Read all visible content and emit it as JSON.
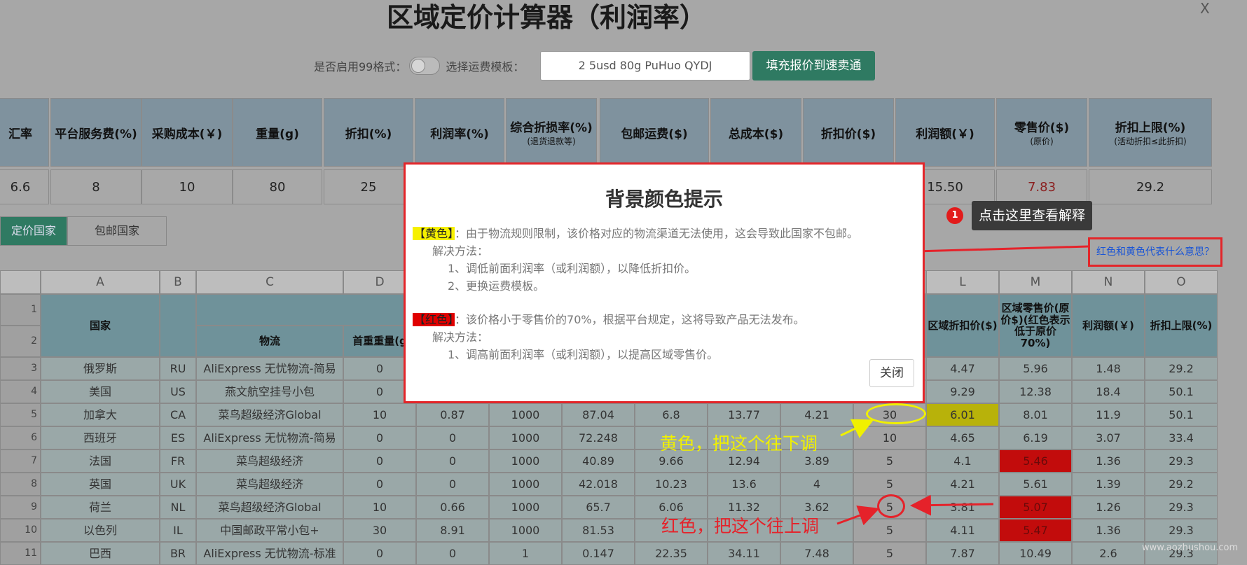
{
  "header": {
    "title": "区域定价计算器（利润率）",
    "close": "X"
  },
  "options": {
    "enable_99_label": "是否启用99格式：",
    "template_label": "选择运费模板：",
    "template_value": "2 5usd 80g PuHuo QYDJ",
    "fill_button": "填充报价到速卖通"
  },
  "params": {
    "headers": [
      {
        "label": "汇率",
        "sub": ""
      },
      {
        "label": "平台服务费(%)",
        "sub": ""
      },
      {
        "label": "采购成本(￥)",
        "sub": ""
      },
      {
        "label": "重量(g)",
        "sub": ""
      },
      {
        "label": "折扣(%)",
        "sub": ""
      },
      {
        "label": "利润率(%)",
        "sub": ""
      },
      {
        "label": "综合折损率(%)",
        "sub": "(退货退款等)"
      },
      {
        "label": "包邮运费($)",
        "sub": ""
      },
      {
        "label": "总成本($)",
        "sub": ""
      },
      {
        "label": "折扣价($)",
        "sub": ""
      },
      {
        "label": "利润额(￥)",
        "sub": ""
      },
      {
        "label": "零售价($)",
        "sub": "(原价)"
      },
      {
        "label": "折扣上限(%)",
        "sub": "(活动折扣≤此折扣)"
      }
    ],
    "values": [
      "6.6",
      "8",
      "10",
      "80",
      "25",
      "",
      "",
      "",
      "",
      "",
      "15.50",
      "7.83",
      "29.2"
    ]
  },
  "tabs": [
    "定价国家",
    "包邮国家"
  ],
  "callout": {
    "badge": "1",
    "text": "点击这里查看解释",
    "help_link": "红色和黄色代表什么意思？"
  },
  "sheet": {
    "columns": [
      "A",
      "B",
      "C",
      "D",
      "L",
      "M",
      "N",
      "O"
    ],
    "row_numbers": [
      "1",
      "2",
      "3",
      "4",
      "5",
      "6",
      "7",
      "8",
      "9",
      "10",
      "11"
    ],
    "group_headers": {
      "country": "国家",
      "logistics": "物流",
      "first_weight": "首重重量(g",
      "region_discount": "区域折扣价($)",
      "region_retail": "区域零售价(原价$)(红色表示低于原价70%)",
      "profit": "利润额(￥)",
      "discount_limit": "折扣上限(%)"
    },
    "rows": [
      {
        "country": "俄罗斯",
        "code": "RU",
        "logistics": "AliExpress 无忧物流-简易",
        "d": "0",
        "e": "",
        "f": "",
        "g": "",
        "h": "",
        "i": "",
        "j": "",
        "k": "",
        "l": "4.47",
        "m": "5.96",
        "n": "1.48",
        "o": "29.2"
      },
      {
        "country": "美国",
        "code": "US",
        "logistics": "燕文航空挂号小包",
        "d": "0",
        "e": "",
        "f": "",
        "g": "",
        "h": "",
        "i": "",
        "j": "",
        "k": "",
        "l": "9.29",
        "m": "12.38",
        "n": "18.4",
        "o": "50.1"
      },
      {
        "country": "加拿大",
        "code": "CA",
        "logistics": "菜鸟超级经济Global",
        "d": "10",
        "e": "0.87",
        "f": "1000",
        "g": "87.04",
        "h": "6.8",
        "i": "13.77",
        "j": "4.21",
        "k": "30",
        "l": "6.01",
        "m": "8.01",
        "n": "11.9",
        "o": "50.1"
      },
      {
        "country": "西班牙",
        "code": "ES",
        "logistics": "AliExpress 无忧物流-简易",
        "d": "0",
        "e": "0",
        "f": "1000",
        "g": "72.248",
        "h": "",
        "i": "",
        "j": "",
        "k": "10",
        "l": "4.65",
        "m": "6.19",
        "n": "3.07",
        "o": "33.4"
      },
      {
        "country": "法国",
        "code": "FR",
        "logistics": "菜鸟超级经济",
        "d": "0",
        "e": "0",
        "f": "1000",
        "g": "40.89",
        "h": "9.66",
        "i": "12.94",
        "j": "3.89",
        "k": "5",
        "l": "4.1",
        "m": "5.46",
        "n": "1.36",
        "o": "29.3"
      },
      {
        "country": "英国",
        "code": "UK",
        "logistics": "菜鸟超级经济",
        "d": "0",
        "e": "0",
        "f": "1000",
        "g": "42.018",
        "h": "10.23",
        "i": "13.6",
        "j": "4",
        "k": "5",
        "l": "4.21",
        "m": "5.61",
        "n": "1.39",
        "o": "29.2"
      },
      {
        "country": "荷兰",
        "code": "NL",
        "logistics": "菜鸟超级经济Global",
        "d": "10",
        "e": "0.66",
        "f": "1000",
        "g": "65.7",
        "h": "6.06",
        "i": "11.32",
        "j": "3.62",
        "k": "5",
        "l": "3.81",
        "m": "5.07",
        "n": "1.26",
        "o": "29.3"
      },
      {
        "country": "以色列",
        "code": "IL",
        "logistics": "中国邮政平常小包+",
        "d": "30",
        "e": "8.91",
        "f": "1000",
        "g": "81.53",
        "h": "",
        "i": "",
        "j": "",
        "k": "5",
        "l": "4.11",
        "m": "5.47",
        "n": "1.36",
        "o": "29.3"
      },
      {
        "country": "巴西",
        "code": "BR",
        "logistics": "AliExpress 无忧物流-标准",
        "d": "0",
        "e": "0",
        "f": "1",
        "g": "0.147",
        "h": "22.35",
        "i": "34.11",
        "j": "7.48",
        "k": "5",
        "l": "7.87",
        "m": "10.49",
        "n": "2.6",
        "o": "29.3"
      }
    ]
  },
  "modal": {
    "title": "背景颜色提示",
    "yellow_tag": "【黄色】",
    "yellow_text": "：由于物流规则限制，该价格对应的物流渠道无法使用，这会导致此国家不包邮。",
    "yellow_solution": "解决方法：",
    "yellow_fix1": "1、调低前面利润率（或利润额），以降低折扣价。",
    "yellow_fix2": "2、更换运费模板。",
    "red_tag": "【红色】",
    "red_text": "：该价格小于零售价的70%，根据平台规定，这将导致产品无法发布。",
    "red_solution": "解决方法：",
    "red_fix1": "1、调高前面利润率（或利润额），以提高区域零售价。",
    "close": "关闭"
  },
  "annotations": {
    "yellow": "黄色，把这个往下调",
    "red": "红色，把这个往上调"
  },
  "watermark": "www.aozhushou.com",
  "colors": {
    "accent_green": "#2f7a62",
    "highlight_red": "#e3262a",
    "cell_yellow": "#b8b20a",
    "cell_red": "#c20c0c"
  }
}
